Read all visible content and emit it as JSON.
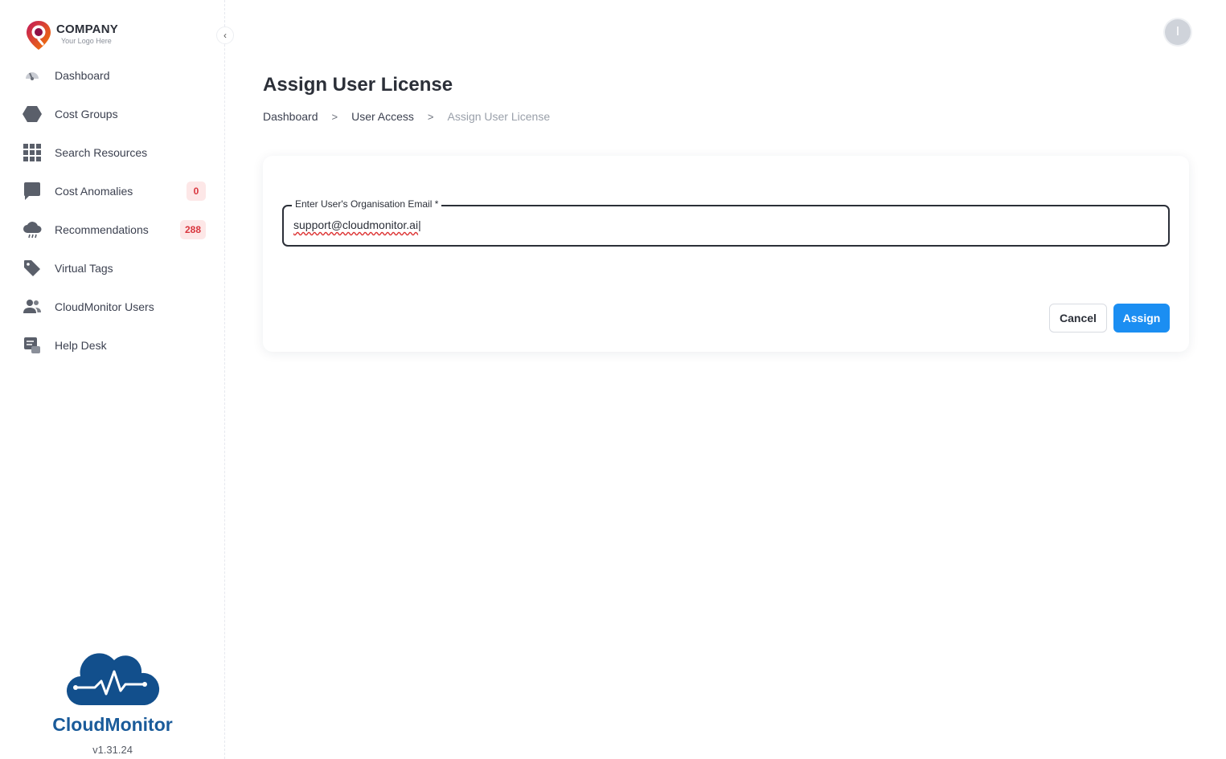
{
  "logo": {
    "name": "COMPANY",
    "tagline": "Your Logo Here"
  },
  "sidebar": {
    "items": [
      {
        "label": "Dashboard",
        "icon": "gauge-icon"
      },
      {
        "label": "Cost Groups",
        "icon": "hexagon-icon"
      },
      {
        "label": "Search Resources",
        "icon": "grid-icon"
      },
      {
        "label": "Cost Anomalies",
        "icon": "chat-bubble-icon",
        "badge": "0"
      },
      {
        "label": "Recommendations",
        "icon": "cloud-icon",
        "badge": "288"
      },
      {
        "label": "Virtual Tags",
        "icon": "tag-icon"
      },
      {
        "label": "CloudMonitor Users",
        "icon": "users-icon"
      },
      {
        "label": "Help Desk",
        "icon": "help-desk-icon"
      }
    ]
  },
  "brand": {
    "name": "CloudMonitor",
    "version": "v1.31.24"
  },
  "user": {
    "avatar_initial": "I"
  },
  "page": {
    "title": "Assign User License",
    "breadcrumb": [
      "Dashboard",
      "User Access",
      "Assign User License"
    ],
    "breadcrumb_separator": ">"
  },
  "form": {
    "email_label": "Enter User's Organisation Email *",
    "email_value": "support@cloudmonitor.ai",
    "cancel_label": "Cancel",
    "assign_label": "Assign"
  },
  "colors": {
    "primary": "#1b8ef2",
    "badge_bg": "#fde7e7",
    "badge_text": "#d9363e",
    "brand": "#1a5b9a"
  }
}
